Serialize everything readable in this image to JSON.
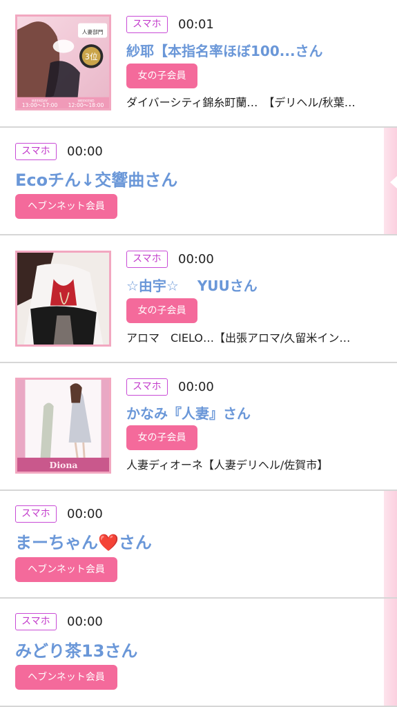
{
  "entries": [
    {
      "device_tag": "スマホ",
      "time": "00:01",
      "name": "紗耶【本指名率ほぼ100...さん",
      "member_type": "女の子会員",
      "shop": "ダイバーシティ錦糸町蘭…　【デリヘル/秋葉…",
      "thumb_text": [
        "人妻部門",
        "WEEKDAY",
        "WEEKEND",
        "13:00〜17:00",
        "12:00〜18:00",
        "3位"
      ]
    },
    {
      "device_tag": "スマホ",
      "time": "00:00",
      "name": "Ecoチん↓交響曲さん",
      "member_type": "ヘブンネット会員"
    },
    {
      "device_tag": "スマホ",
      "time": "00:00",
      "name": "☆由宇☆　 YUUさん",
      "member_type": "女の子会員",
      "shop": "アロマ　CIELO…【出張アロマ/久留米イン…"
    },
    {
      "device_tag": "スマホ",
      "time": "00:00",
      "name": "かなみ『人妻』さん",
      "member_type": "女の子会員",
      "shop": "人妻ディオーネ【人妻デリヘル/佐賀市】",
      "thumb_text": [
        "Diona"
      ]
    },
    {
      "device_tag": "スマホ",
      "time": "00:00",
      "name": "まーちゃん❤️さん",
      "member_type": "ヘブンネット会員"
    },
    {
      "device_tag": "スマホ",
      "time": "00:00",
      "name": "みどり茶13さん",
      "member_type": "ヘブンネット会員"
    }
  ],
  "colors": {
    "accent_pink": "#f46a9b",
    "tag_border": "#c84ad6",
    "name_blue": "#6a97d8",
    "thumb_border": "#f2a7c0"
  }
}
